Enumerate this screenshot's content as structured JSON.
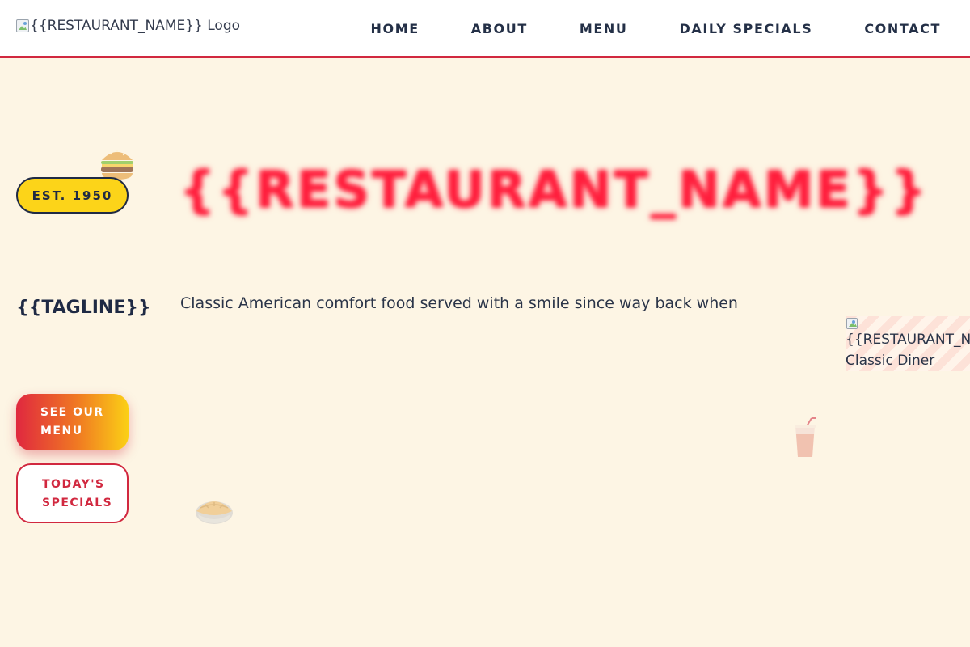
{
  "header": {
    "logo_alt": "{{RESTAURANT_NAME}} Logo",
    "nav": [
      {
        "label": "HOME"
      },
      {
        "label": "ABOUT"
      },
      {
        "label": "MENU"
      },
      {
        "label": "DAILY SPECIALS"
      },
      {
        "label": "CONTACT"
      }
    ]
  },
  "hero": {
    "badge": "EST. 1950",
    "title": "{{RESTAURANT_NAME}}",
    "tagline": "{{TAGLINE}}",
    "description": "Classic American comfort food served with a smile since way back when",
    "primary_button": "SEE OUR MENU",
    "secondary_button": "TODAY'S SPECIALS",
    "image_alt_line1": "{{RESTAURANT_NAME}}",
    "image_alt_line2": "Classic Diner",
    "decorations": [
      "burger-icon",
      "drink-icon",
      "pie-icon"
    ]
  },
  "colors": {
    "accent_red": "#d1283f",
    "badge_yellow": "#fcd419",
    "background": "#fdf5e4",
    "navy": "#1f2a44"
  }
}
